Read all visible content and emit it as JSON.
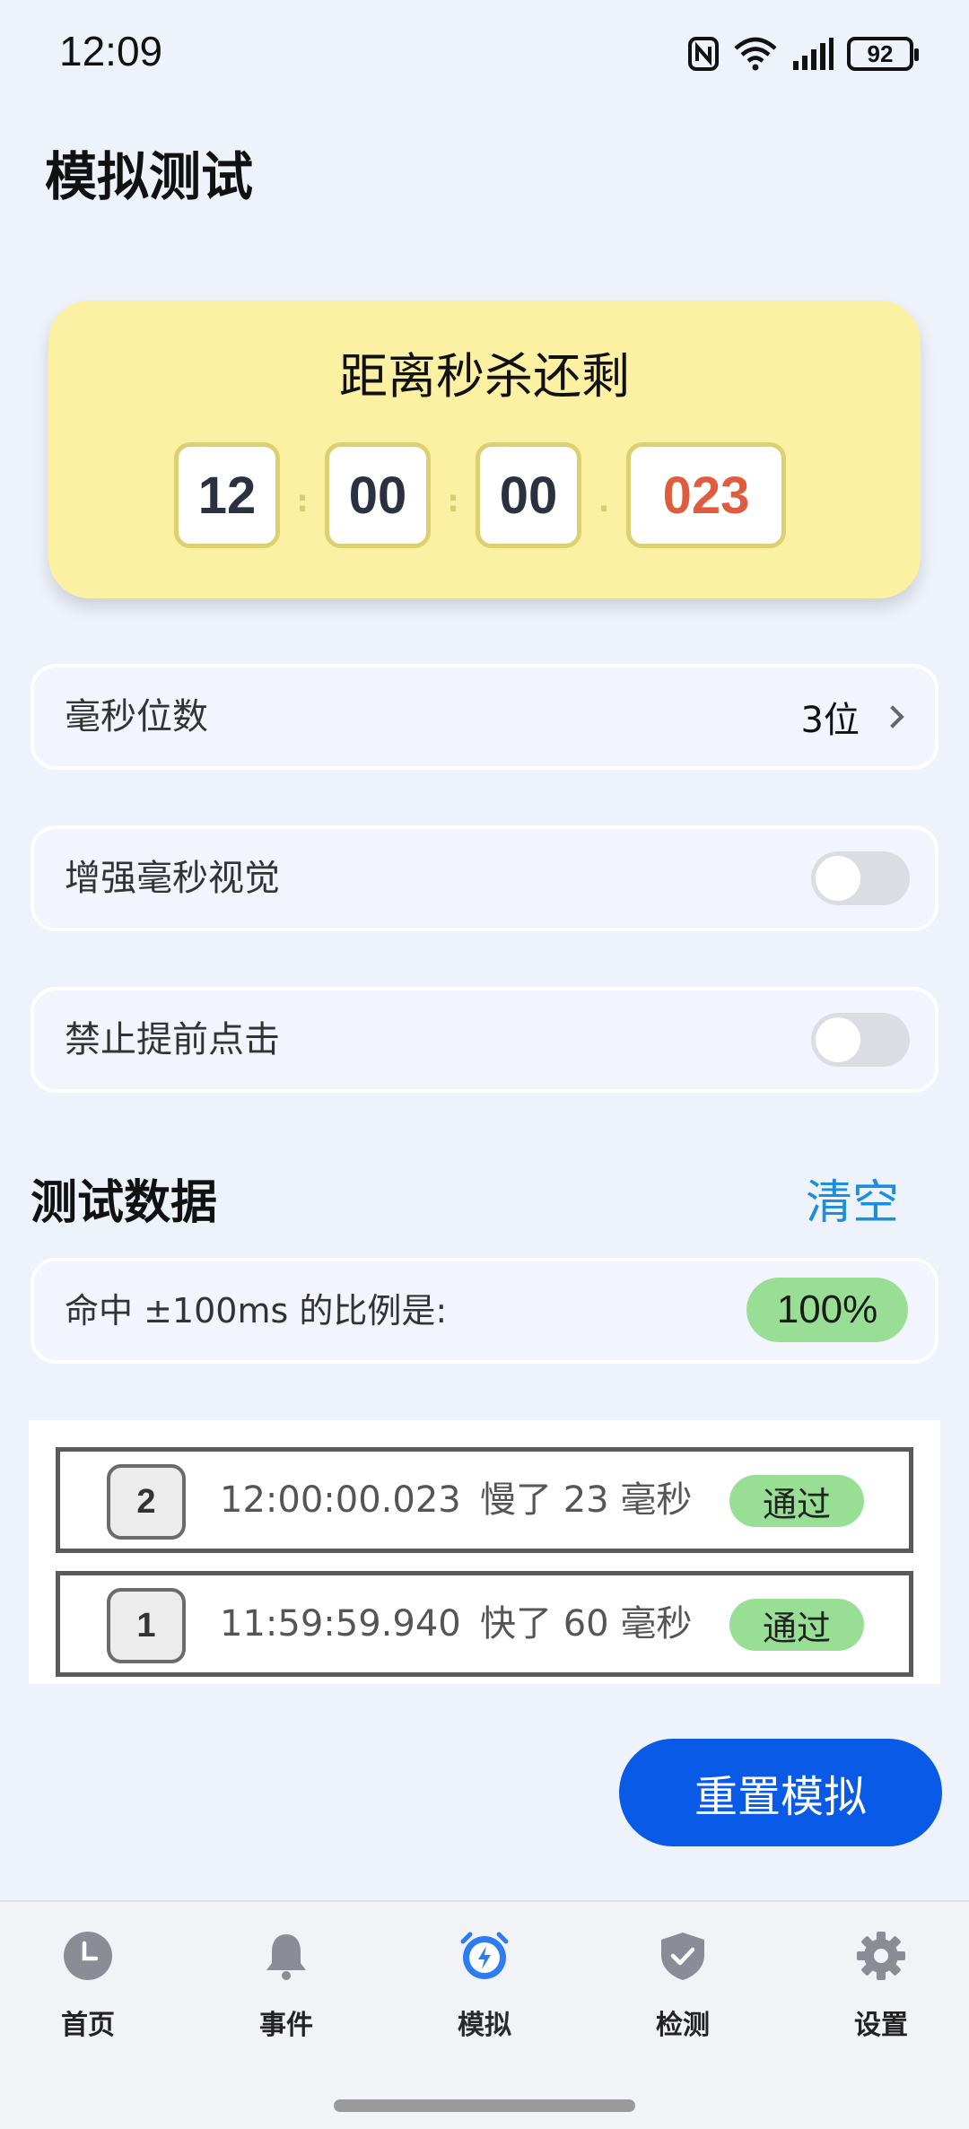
{
  "status_bar": {
    "time": "12:09",
    "battery": "92"
  },
  "page": {
    "title": "模拟测试"
  },
  "countdown": {
    "title": "距离秒杀还剩",
    "hours": "12",
    "minutes": "00",
    "seconds": "00",
    "milliseconds": "023",
    "sep1": ":",
    "sep2": ":",
    "sep3": "."
  },
  "settings": {
    "ms_digits": {
      "label": "毫秒位数",
      "value": "3位"
    },
    "enhance_ms": {
      "label": "增强毫秒视觉",
      "enabled": false
    },
    "forbid_early": {
      "label": "禁止提前点击",
      "enabled": false
    }
  },
  "test_data": {
    "title": "测试数据",
    "clear_label": "清空",
    "ratio_label": "命中 ±100ms 的比例是:",
    "ratio_value": "100%",
    "records": [
      {
        "index": "2",
        "time": "12:00:00.023",
        "diff": "慢了 23 毫秒",
        "status": "通过"
      },
      {
        "index": "1",
        "time": "11:59:59.940",
        "diff": "快了 60 毫秒",
        "status": "通过"
      }
    ]
  },
  "reset_label": "重置模拟",
  "colors": {
    "accent": "#0a5ae8",
    "card_yellow": "#fcf0a2",
    "pass_green": "#98df95",
    "ms_red": "#e05c3f",
    "link_blue": "#1a8fdf"
  },
  "tabbar": {
    "items": [
      {
        "label": "首页",
        "icon": "clock-icon"
      },
      {
        "label": "事件",
        "icon": "bell-icon"
      },
      {
        "label": "模拟",
        "icon": "lightning-alarm-icon",
        "active": true
      },
      {
        "label": "检测",
        "icon": "shield-check-icon"
      },
      {
        "label": "设置",
        "icon": "gear-icon"
      }
    ]
  }
}
